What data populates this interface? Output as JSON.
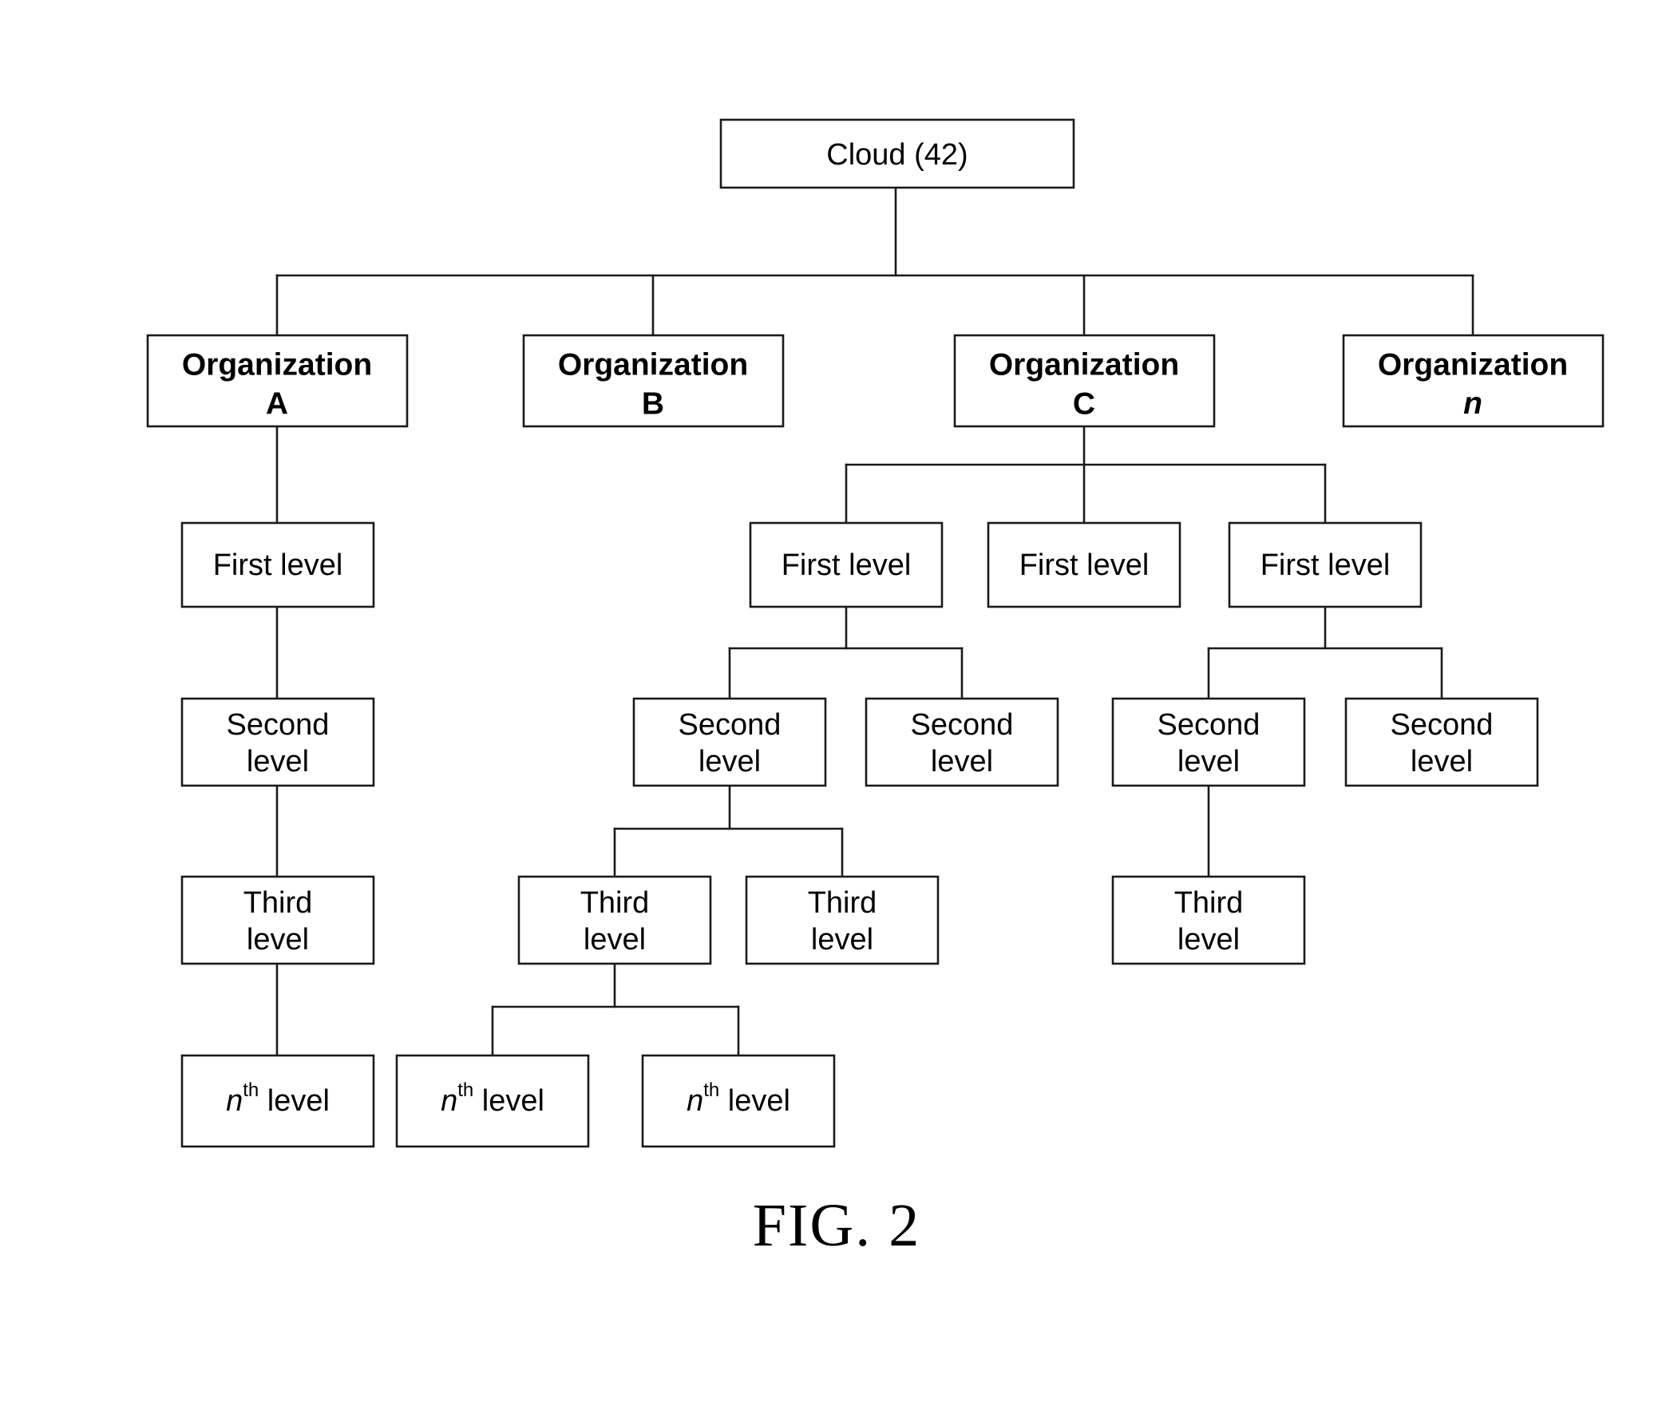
{
  "figure": {
    "caption": "FIG. 2",
    "root": {
      "label": "Cloud (42)"
    },
    "organizations": [
      {
        "line1": "Organization",
        "line2": "A",
        "italic_line2": false
      },
      {
        "line1": "Organization",
        "line2": "B",
        "italic_line2": false
      },
      {
        "line1": "Organization",
        "line2": "C",
        "italic_line2": false
      },
      {
        "line1": "Organization",
        "line2": "n",
        "italic_line2": true
      }
    ],
    "levels": {
      "first": "First level",
      "second_line1": "Second",
      "second_line2": "level",
      "third_line1": "Third",
      "third_line2": "level",
      "nth_base": "n",
      "nth_sup": "th",
      "nth_suffix": " level"
    },
    "nodes": {
      "org_a_first": "First level",
      "org_a_second_l1": "Second",
      "org_a_second_l2": "level",
      "org_a_third_l1": "Third",
      "org_a_third_l2": "level",
      "org_a_nth_base": "n",
      "org_a_nth_sup": "th",
      "org_a_nth_suffix": " level",
      "org_c_first_1": "First level",
      "org_c_first_2": "First level",
      "org_c_first_3": "First level",
      "org_c_second_1_l1": "Second",
      "org_c_second_1_l2": "level",
      "org_c_second_2_l1": "Second",
      "org_c_second_2_l2": "level",
      "org_c_second_3_l1": "Second",
      "org_c_second_3_l2": "level",
      "org_c_second_4_l1": "Second",
      "org_c_second_4_l2": "level",
      "org_c_third_1_l1": "Third",
      "org_c_third_1_l2": "level",
      "org_c_third_2_l1": "Third",
      "org_c_third_2_l2": "level",
      "org_c_third_3_l1": "Third",
      "org_c_third_3_l2": "level",
      "org_c_nth_1_base": "n",
      "org_c_nth_1_sup": "th",
      "org_c_nth_1_suffix": " level",
      "org_c_nth_2_base": "n",
      "org_c_nth_2_sup": "th",
      "org_c_nth_2_suffix": " level"
    },
    "colors": {
      "stroke": "#1a1a1a",
      "fill": "#ffffff",
      "text": "#000000"
    }
  }
}
